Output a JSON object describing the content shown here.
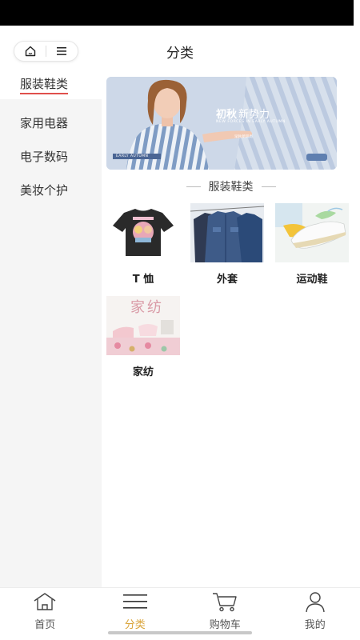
{
  "header": {
    "title": "分类"
  },
  "sidebar": {
    "items": [
      {
        "label": "服装鞋类"
      },
      {
        "label": "家用电器"
      },
      {
        "label": "电子数码"
      },
      {
        "label": "美妆个护"
      }
    ]
  },
  "banner": {
    "headline_a": "初秋",
    "headline_b": "新势力",
    "subline": "NEW FORCES IN EARLY AUTUMN",
    "tagline": "早秋新风尚",
    "tag": "EARLY AUTUMN"
  },
  "section": {
    "title": "服装鞋类"
  },
  "products": [
    {
      "name": "T 恤"
    },
    {
      "name": "外套"
    },
    {
      "name": "运动鞋"
    },
    {
      "name": "家纺",
      "image_text": "家纺"
    }
  ],
  "tabbar": {
    "items": [
      {
        "label": "首页"
      },
      {
        "label": "分类"
      },
      {
        "label": "购物车"
      },
      {
        "label": "我的"
      }
    ]
  },
  "colors": {
    "accent": "#d9a337",
    "active_underline": "#e0504c",
    "sidebar_bg": "#f5f5f5"
  }
}
